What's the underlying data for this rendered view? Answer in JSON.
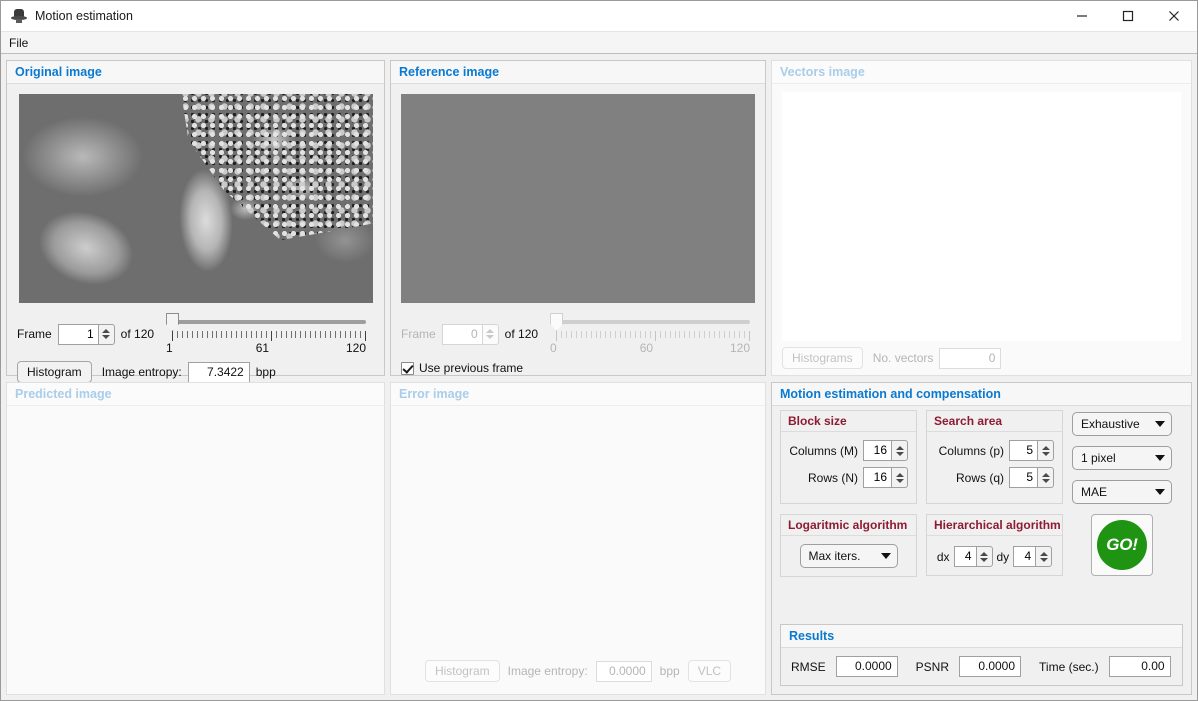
{
  "window": {
    "title": "Motion estimation",
    "icon": "matlab-app-icon",
    "minimize": "minimize-icon",
    "maximize": "maximize-icon",
    "close": "close-icon"
  },
  "menu": {
    "items": [
      {
        "label": "File"
      }
    ]
  },
  "colors": {
    "panel_title": "#0a7ad1",
    "panel_title_disabled": "#a9cdea",
    "group_title": "#8e1b32",
    "go_green": "#1f9412",
    "window_bg": "#f0f0f0"
  },
  "original_image": {
    "title": "Original image",
    "frame_label": "Frame",
    "frame_value": "1",
    "of_label": "of 120",
    "slider": {
      "min": "1",
      "mid": "61",
      "max": "120",
      "value": 1
    },
    "histogram_button": "Histogram",
    "entropy_label": "Image entropy:",
    "entropy_value": "7.3422",
    "entropy_units": "bpp"
  },
  "reference_image": {
    "title": "Reference image",
    "frame_label": "Frame",
    "frame_value": "0",
    "of_label": "of 120",
    "slider": {
      "min": "0",
      "mid": "60",
      "max": "120",
      "value": 0
    },
    "use_previous_frame_label": "Use previous frame",
    "use_previous_frame_checked": true
  },
  "vectors_image": {
    "title": "Vectors image",
    "histograms_button": "Histograms",
    "no_vectors_label": "No. vectors",
    "no_vectors_value": "0"
  },
  "predicted_image": {
    "title": "Predicted image"
  },
  "error_image": {
    "title": "Error image",
    "histogram_button": "Histogram",
    "entropy_label": "Image entropy:",
    "entropy_value": "0.0000",
    "entropy_units": "bpp",
    "vlc_button": "VLC"
  },
  "motion_estimation": {
    "title": "Motion estimation and compensation",
    "block_size": {
      "title": "Block size",
      "columns_label": "Columns (M)",
      "columns_value": "16",
      "rows_label": "Rows (N)",
      "rows_value": "16"
    },
    "search_area": {
      "title": "Search area",
      "columns_label": "Columns (p)",
      "columns_value": "5",
      "rows_label": "Rows (q)",
      "rows_value": "5"
    },
    "algorithm_dropdown": "Exhaustive",
    "precision_dropdown": "1 pixel",
    "metric_dropdown": "MAE",
    "logarithmic": {
      "title": "Logaritmic algorithm",
      "dropdown": "Max iters."
    },
    "hierarchical": {
      "title": "Hierarchical algorithm",
      "dx_label": "dx",
      "dx_value": "4",
      "dy_label": "dy",
      "dy_value": "4"
    },
    "go_button": "GO!"
  },
  "results": {
    "title": "Results",
    "rmse_label": "RMSE",
    "rmse_value": "0.0000",
    "psnr_label": "PSNR",
    "psnr_value": "0.0000",
    "time_label": "Time (sec.)",
    "time_value": "0.00"
  }
}
